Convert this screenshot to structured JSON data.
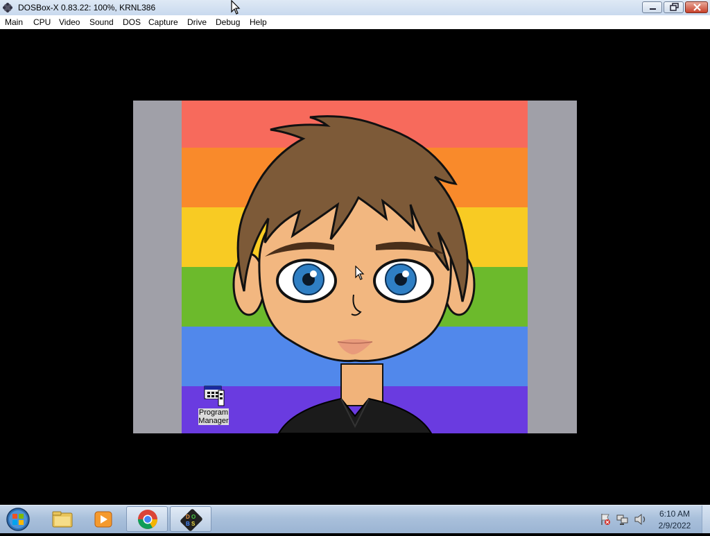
{
  "window": {
    "title": "DOSBox-X 0.83.22: 100%, KRNL386"
  },
  "menu": [
    "Main",
    "CPU",
    "Video",
    "Sound",
    "DOS",
    "Capture",
    "Drive",
    "Debug",
    "Help"
  ],
  "emulated_desktop": {
    "wallpaper_stripes": [
      "#f76a5c",
      "#f98a2b",
      "#f8cb23",
      "#6cba2c",
      "#5188eb",
      "#6a3be0"
    ],
    "desktop_icon": {
      "label_line1": "Program",
      "label_line2": "Manager",
      "icon": "program-manager-icon"
    }
  },
  "taskbar": {
    "pinned": [
      {
        "name": "windows-explorer-icon"
      },
      {
        "name": "media-player-icon"
      },
      {
        "name": "chrome-icon"
      },
      {
        "name": "dosbox-icon"
      }
    ],
    "tray_icons": [
      "action-center-flag-icon",
      "network-icon",
      "volume-icon"
    ],
    "clock_time": "6:10 AM",
    "clock_date": "2/9/2022"
  }
}
